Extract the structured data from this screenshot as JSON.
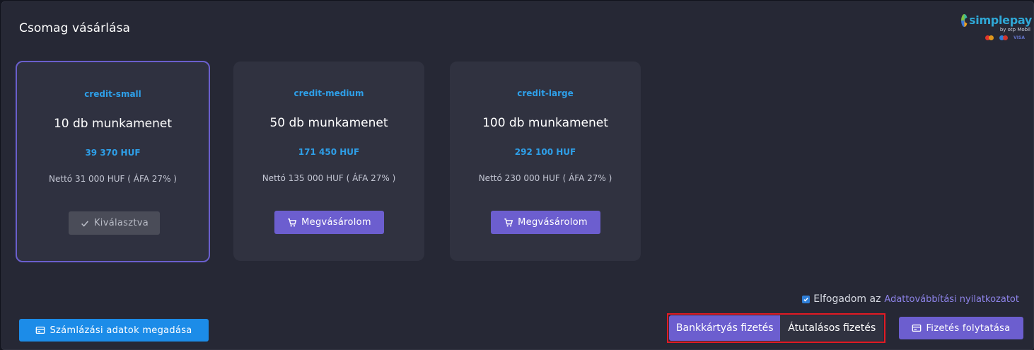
{
  "page": {
    "title": "Csomag vásárlása"
  },
  "logo": {
    "brand": "simplepay",
    "sub": "by otp Mobil",
    "visa": "VISA"
  },
  "packages": [
    {
      "slug": "credit-small",
      "name": "10 db munkamenet",
      "price": "39 370 HUF",
      "net": "Nettó 31 000 HUF ( ÁFA 27% )",
      "button": "Kiválasztva",
      "selected": true
    },
    {
      "slug": "credit-medium",
      "name": "50 db munkamenet",
      "price": "171 450 HUF",
      "net": "Nettó 135 000 HUF ( ÁFA 27% )",
      "button": "Megvásárolom",
      "selected": false
    },
    {
      "slug": "credit-large",
      "name": "100 db munkamenet",
      "price": "292 100 HUF",
      "net": "Nettó 230 000 HUF ( ÁFA 27% )",
      "button": "Megvásárolom",
      "selected": false
    }
  ],
  "terms": {
    "text": "Elfogadom az",
    "link": "Adattovábbítási nyilatkozatot",
    "checked": true
  },
  "billing_button": "Számlázási adatok megadása",
  "payment": {
    "card": "Bankkártyás fizetés",
    "transfer": "Átutalásos fizetés",
    "active": "card"
  },
  "continue_button": "Fizetés folytatása",
  "colors": {
    "accent": "#6c5ecf",
    "blue": "#1c8ce8",
    "link_blue": "#2e9fe8",
    "highlight": "#e21b24"
  }
}
